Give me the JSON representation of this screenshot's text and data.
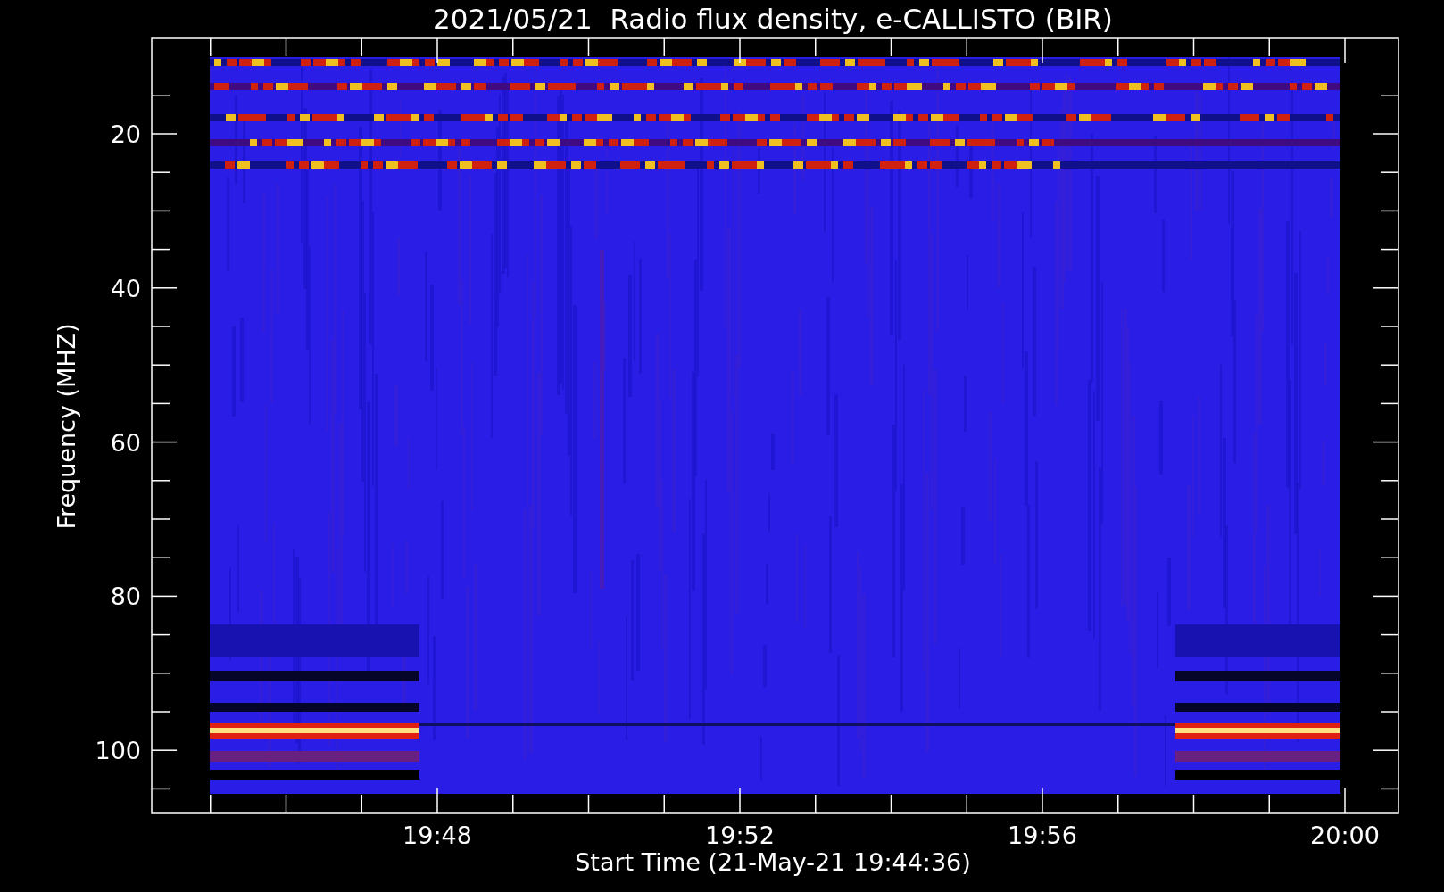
{
  "title": "2021/05/21  Radio flux density, e-CALLISTO (BIR)",
  "xlabel": "Start Time (21-May-21 19:44:36)",
  "ylabel": "Frequency (MHZ)",
  "xtick_labels": [
    "19:48",
    "19:52",
    "19:56",
    "20:00"
  ],
  "ytick_labels": [
    "20",
    "40",
    "60",
    "80",
    "100"
  ]
}
